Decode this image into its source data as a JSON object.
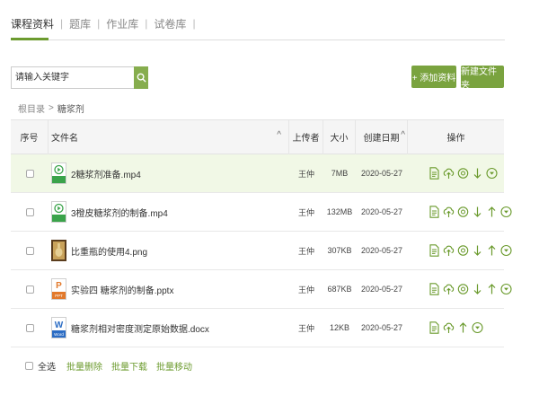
{
  "tabs": [
    {
      "label": "课程资料",
      "active": true
    },
    {
      "label": "题库",
      "active": false
    },
    {
      "label": "作业库",
      "active": false
    },
    {
      "label": "试卷库",
      "active": false
    }
  ],
  "tab_separator": "|",
  "search": {
    "placeholder": "请输入关键字",
    "icon": "search-icon"
  },
  "buttons": {
    "add_label": "+ 添加资料",
    "new_folder_label": "新建文件夹"
  },
  "breadcrumb": {
    "root": "根目录",
    "separator": ">",
    "current": "糖浆剂"
  },
  "table": {
    "headers": {
      "index": "序号",
      "filename": "文件名",
      "uploader": "上传者",
      "size": "大小",
      "date": "创建日期",
      "actions": "操作"
    },
    "sort_arrow": "^",
    "rows": [
      {
        "name": "2糖浆剂准备.mp4",
        "uploader": "王仲",
        "size": "7MB",
        "date": "2020-05-27",
        "type": "video",
        "highlight": true
      },
      {
        "name": "3橙皮糖浆剂的制备.mp4",
        "uploader": "王仲",
        "size": "132MB",
        "date": "2020-05-27",
        "type": "video",
        "highlight": false
      },
      {
        "name": "比重瓶的使用4.png",
        "uploader": "王仲",
        "size": "307KB",
        "date": "2020-05-27",
        "type": "image",
        "highlight": false
      },
      {
        "name": "实验四 糖浆剂的制备.pptx",
        "uploader": "王仲",
        "size": "687KB",
        "date": "2020-05-27",
        "type": "ppt",
        "highlight": false
      },
      {
        "name": "糖浆剂相对密度测定原始数据.docx",
        "uploader": "王仲",
        "size": "12KB",
        "date": "2020-05-27",
        "type": "word",
        "highlight": false
      }
    ]
  },
  "file_icon_text": {
    "ppt": "PPT",
    "word": "W",
    "word_sub": "Word"
  },
  "footer": {
    "select_all": "全选",
    "batch_delete": "批量删除",
    "batch_download": "批量下载",
    "batch_move": "批量移动"
  },
  "colors": {
    "accent": "#7aa33f",
    "highlight_row": "#f1f8e6",
    "icon_green": "#6a9a2c"
  }
}
